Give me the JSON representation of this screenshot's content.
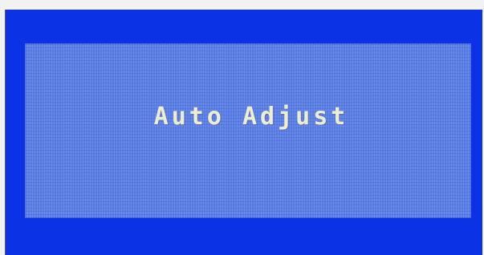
{
  "osd": {
    "message": "Auto Adjust"
  },
  "colors": {
    "frame_blue": "#0c32e6",
    "panel_blue": "#5a7fe6",
    "text": "#eeeecf"
  }
}
